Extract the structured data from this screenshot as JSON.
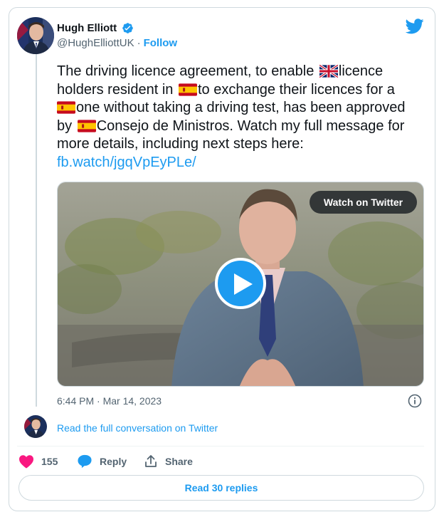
{
  "author": {
    "name": "Hugh Elliott",
    "handle": "@HughElliottUK",
    "separator": "·",
    "follow_label": "Follow"
  },
  "tweet": {
    "line1_a": "The driving licence agreement, to enable ",
    "line1_b": "licence",
    "line2_a": "holders resident in ",
    "line2_b": "to exchange their licences for a",
    "line3_b": "one without taking a driving test, has been approved",
    "line4_a": "by ",
    "line4_b": "Consejo de Ministros. Watch my full message for",
    "line5": "more details, including next steps here:",
    "link": "fb.watch/jgqVpEyPLe/"
  },
  "media": {
    "watch_label": "Watch on Twitter"
  },
  "timestamp": "6:44 PM · Mar 14, 2023",
  "read_full_label": "Read the full conversation on Twitter",
  "actions": {
    "like_count": "155",
    "reply_label": "Reply",
    "share_label": "Share"
  },
  "read_replies_label": "Read 30 replies",
  "colors": {
    "accent": "#1d9bf0",
    "like": "#f91880",
    "secondary_text": "#536471",
    "border": "#cfd9de"
  },
  "icons": [
    "verified-badge-icon",
    "twitter-bird-icon",
    "uk-flag-icon",
    "spain-flag-icon",
    "play-icon",
    "info-icon",
    "heart-icon",
    "reply-icon",
    "share-icon"
  ]
}
